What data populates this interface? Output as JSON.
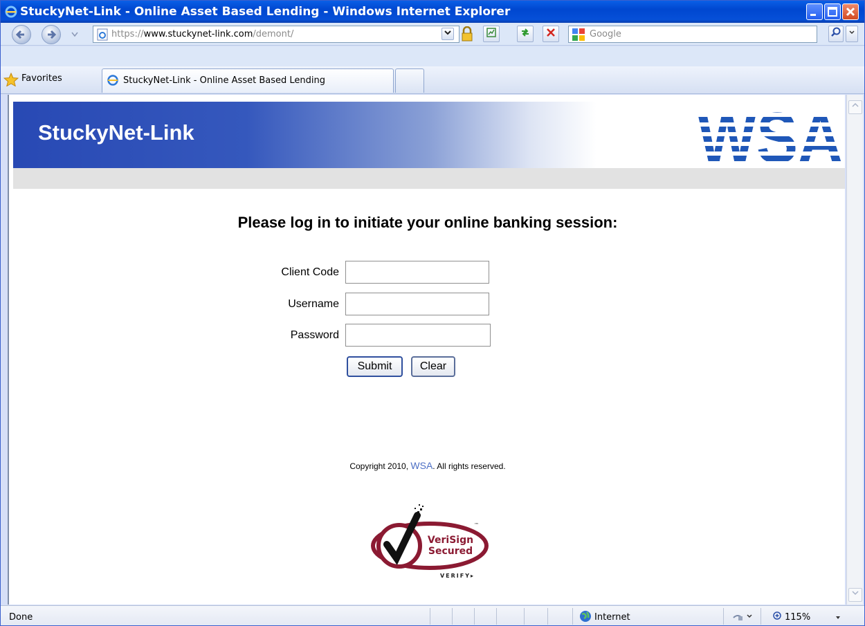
{
  "window": {
    "title": "StuckyNet-Link - Online Asset Based Lending - Windows Internet Explorer"
  },
  "address_bar": {
    "url_prefix": "https://",
    "url_host": "www.stuckynet-link.com",
    "url_path": "/demont/"
  },
  "search": {
    "placeholder": "Google"
  },
  "favorites": {
    "label": "Favorites"
  },
  "tabs": [
    {
      "label": "StuckyNet-Link - Online Asset Based Lending",
      "active": true
    }
  ],
  "page": {
    "brand": "StuckyNet-Link",
    "logo_text": "WSA",
    "heading": "Please log in to initiate your online banking session:",
    "fields": [
      {
        "label": "Client Code",
        "value": ""
      },
      {
        "label": "Username",
        "value": ""
      },
      {
        "label": "Password",
        "value": ""
      }
    ],
    "submit_label": "Submit",
    "clear_label": "Clear",
    "copyright_before": "Copyright 2010, ",
    "copyright_link": "WSA",
    "copyright_after": ". All rights reserved.",
    "seal": {
      "line1": "VeriSign",
      "line2": "Secured",
      "verify": "VERIFY▸",
      "tm": "™"
    }
  },
  "status_bar": {
    "status": "Done",
    "zone": "Internet",
    "zoom": "115%"
  },
  "colors": {
    "banner_blue": "#2849b4",
    "link": "#4d6fc4",
    "seal_red": "#8b1a32"
  }
}
